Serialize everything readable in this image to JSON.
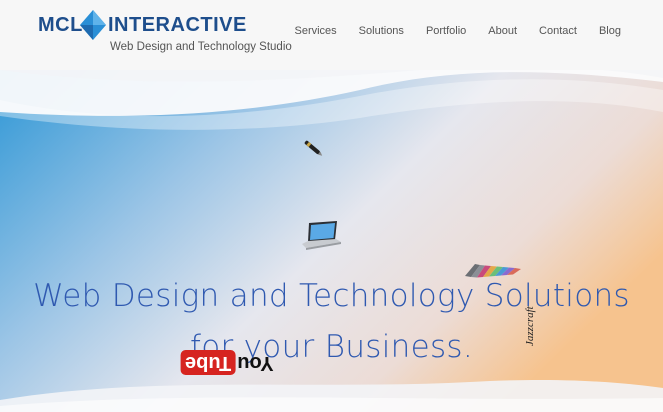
{
  "brand": {
    "name_left": "MCL",
    "name_right": "INTERACTIVE",
    "tagline": "Web Design and Technology Studio",
    "primary_color": "#1e4e8c",
    "accent_color": "#2a8fd6"
  },
  "nav": {
    "items": [
      {
        "label": "Services"
      },
      {
        "label": "Solutions"
      },
      {
        "label": "Portfolio"
      },
      {
        "label": "About"
      },
      {
        "label": "Contact"
      },
      {
        "label": "Blog"
      }
    ]
  },
  "hero": {
    "title_line1": "Web Design and Technology Solutions",
    "title_line2": "for your Business.",
    "title_color": "#2f59b0"
  },
  "floating_icons": {
    "pen": "pen-icon",
    "laptop": "laptop-icon",
    "color_swatch": "color-swatch-icon",
    "youtube": {
      "text_left": "You",
      "text_right": "Tube"
    },
    "jazzcraft": {
      "text": "Jazzcraft"
    }
  }
}
